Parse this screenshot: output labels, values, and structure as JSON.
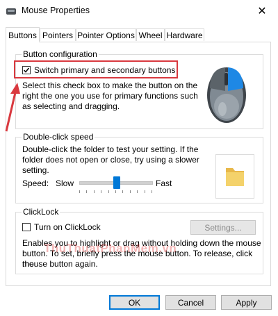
{
  "window": {
    "title": "Mouse Properties",
    "close_glyph": "✕"
  },
  "tabs": [
    "Buttons",
    "Pointers",
    "Pointer Options",
    "Wheel",
    "Hardware"
  ],
  "button_config": {
    "group_label": "Button configuration",
    "switch_label": "Switch primary and secondary buttons",
    "switch_checked": true,
    "description": [
      "Select this check box to make the button on the",
      "right the one you use for primary functions such",
      "as selecting and dragging."
    ]
  },
  "double_click": {
    "group_label": "Double-click speed",
    "description": [
      "Double-click the folder to test your setting.  If the",
      "folder does not open or close, try using a slower",
      "setting."
    ],
    "speed_label": "Speed:",
    "slow_label": "Slow",
    "fast_label": "Fast",
    "speed_level": 0.52
  },
  "clicklock": {
    "group_label": "ClickLock",
    "toggle_label": "Turn on ClickLock",
    "toggle_checked": false,
    "settings_label": "Settings...",
    "description": [
      "Enables you to highlight or drag without holding down the mouse",
      "button.  To set, briefly press the mouse button.  To release, click the",
      "mouse button again."
    ]
  },
  "footer": {
    "ok": "OK",
    "cancel": "Cancel",
    "apply": "Apply"
  },
  "watermark": "ThuThuatPhanMem.vn",
  "colors": {
    "highlight": "#d9393f",
    "accent": "#0078d7",
    "mouse_blue": "#1e88e5",
    "folder": "#f4d26b"
  }
}
